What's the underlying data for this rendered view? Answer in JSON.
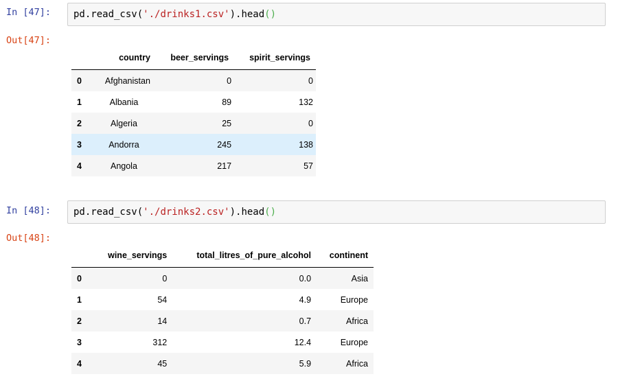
{
  "cells": [
    {
      "in_prompt": "In [47]:",
      "out_prompt": "Out[47]:",
      "code": {
        "prefix": "pd.read_csv(",
        "string": "'./drinks1.csv'",
        "middle": ").head",
        "parens": "()"
      },
      "table": {
        "columns": [
          "country",
          "beer_servings",
          "spirit_servings"
        ],
        "rows": [
          {
            "index": "0",
            "values": [
              "Afghanistan",
              "0",
              "0"
            ]
          },
          {
            "index": "1",
            "values": [
              "Albania",
              "89",
              "132"
            ]
          },
          {
            "index": "2",
            "values": [
              "Algeria",
              "25",
              "0"
            ]
          },
          {
            "index": "3",
            "values": [
              "Andorra",
              "245",
              "138"
            ]
          },
          {
            "index": "4",
            "values": [
              "Angola",
              "217",
              "57"
            ]
          }
        ]
      }
    },
    {
      "in_prompt": "In [48]:",
      "out_prompt": "Out[48]:",
      "code": {
        "prefix": "pd.read_csv(",
        "string": "'./drinks2.csv'",
        "middle": ").head",
        "parens": "()"
      },
      "table": {
        "columns": [
          "wine_servings",
          "total_litres_of_pure_alcohol",
          "continent"
        ],
        "rows": [
          {
            "index": "0",
            "values": [
              "0",
              "0.0",
              "Asia"
            ]
          },
          {
            "index": "1",
            "values": [
              "54",
              "4.9",
              "Europe"
            ]
          },
          {
            "index": "2",
            "values": [
              "14",
              "0.7",
              "Africa"
            ]
          },
          {
            "index": "3",
            "values": [
              "312",
              "12.4",
              "Europe"
            ]
          },
          {
            "index": "4",
            "values": [
              "45",
              "5.9",
              "Africa"
            ]
          }
        ]
      }
    }
  ],
  "colors": {
    "in_prompt": "#303f9f",
    "out_prompt": "#d84315",
    "string": "#ba2121",
    "paren": "#4cae4c",
    "hover_row": "#dceffc",
    "stripe_row": "#f5f5f5"
  }
}
